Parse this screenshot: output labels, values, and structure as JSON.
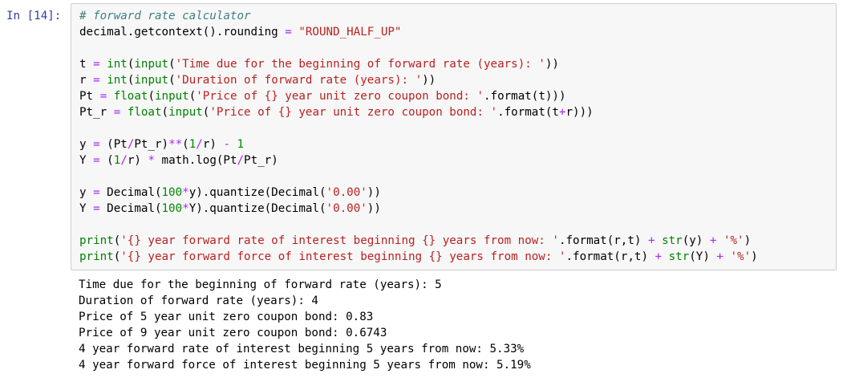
{
  "cell": {
    "prompt": "In [14]:",
    "code_lines": [
      [
        {
          "t": "# forward rate calculator",
          "c": "cm"
        }
      ],
      [
        {
          "t": "decimal.getcontext().rounding ",
          "c": ""
        },
        {
          "t": "=",
          "c": "op"
        },
        {
          "t": " ",
          "c": ""
        },
        {
          "t": "\"ROUND_HALF_UP\"",
          "c": "st"
        }
      ],
      [],
      [
        {
          "t": "t ",
          "c": ""
        },
        {
          "t": "=",
          "c": "op"
        },
        {
          "t": " ",
          "c": ""
        },
        {
          "t": "int",
          "c": "kw"
        },
        {
          "t": "(",
          "c": ""
        },
        {
          "t": "input",
          "c": "kw"
        },
        {
          "t": "(",
          "c": ""
        },
        {
          "t": "'Time due for the beginning of forward rate (years): '",
          "c": "st"
        },
        {
          "t": "))",
          "c": ""
        }
      ],
      [
        {
          "t": "r ",
          "c": ""
        },
        {
          "t": "=",
          "c": "op"
        },
        {
          "t": " ",
          "c": ""
        },
        {
          "t": "int",
          "c": "kw"
        },
        {
          "t": "(",
          "c": ""
        },
        {
          "t": "input",
          "c": "kw"
        },
        {
          "t": "(",
          "c": ""
        },
        {
          "t": "'Duration of forward rate (years): '",
          "c": "st"
        },
        {
          "t": "))",
          "c": ""
        }
      ],
      [
        {
          "t": "Pt ",
          "c": ""
        },
        {
          "t": "=",
          "c": "op"
        },
        {
          "t": " ",
          "c": ""
        },
        {
          "t": "float",
          "c": "kw"
        },
        {
          "t": "(",
          "c": ""
        },
        {
          "t": "input",
          "c": "kw"
        },
        {
          "t": "(",
          "c": ""
        },
        {
          "t": "'Price of {} year unit zero coupon bond: '",
          "c": "st"
        },
        {
          "t": ".format(t)))",
          "c": ""
        }
      ],
      [
        {
          "t": "Pt_r ",
          "c": ""
        },
        {
          "t": "=",
          "c": "op"
        },
        {
          "t": " ",
          "c": ""
        },
        {
          "t": "float",
          "c": "kw"
        },
        {
          "t": "(",
          "c": ""
        },
        {
          "t": "input",
          "c": "kw"
        },
        {
          "t": "(",
          "c": ""
        },
        {
          "t": "'Price of {} year unit zero coupon bond: '",
          "c": "st"
        },
        {
          "t": ".format(t",
          "c": ""
        },
        {
          "t": "+",
          "c": "op"
        },
        {
          "t": "r)))",
          "c": ""
        }
      ],
      [],
      [
        {
          "t": "y ",
          "c": ""
        },
        {
          "t": "=",
          "c": "op"
        },
        {
          "t": " (Pt",
          "c": ""
        },
        {
          "t": "/",
          "c": "op"
        },
        {
          "t": "Pt_r)",
          "c": ""
        },
        {
          "t": "**",
          "c": "op"
        },
        {
          "t": "(",
          "c": ""
        },
        {
          "t": "1",
          "c": "nu"
        },
        {
          "t": "/",
          "c": "op"
        },
        {
          "t": "r) ",
          "c": ""
        },
        {
          "t": "-",
          "c": "op"
        },
        {
          "t": " ",
          "c": ""
        },
        {
          "t": "1",
          "c": "nu"
        }
      ],
      [
        {
          "t": "Y ",
          "c": ""
        },
        {
          "t": "=",
          "c": "op"
        },
        {
          "t": " (",
          "c": ""
        },
        {
          "t": "1",
          "c": "nu"
        },
        {
          "t": "/",
          "c": "op"
        },
        {
          "t": "r) ",
          "c": ""
        },
        {
          "t": "*",
          "c": "op"
        },
        {
          "t": " math.log(Pt",
          "c": ""
        },
        {
          "t": "/",
          "c": "op"
        },
        {
          "t": "Pt_r)",
          "c": ""
        }
      ],
      [],
      [
        {
          "t": "y ",
          "c": ""
        },
        {
          "t": "=",
          "c": "op"
        },
        {
          "t": " Decimal(",
          "c": ""
        },
        {
          "t": "100",
          "c": "nu"
        },
        {
          "t": "*",
          "c": "op"
        },
        {
          "t": "y).quantize(Decimal(",
          "c": ""
        },
        {
          "t": "'0.00'",
          "c": "st"
        },
        {
          "t": "))",
          "c": ""
        }
      ],
      [
        {
          "t": "Y ",
          "c": ""
        },
        {
          "t": "=",
          "c": "op"
        },
        {
          "t": " Decimal(",
          "c": ""
        },
        {
          "t": "100",
          "c": "nu"
        },
        {
          "t": "*",
          "c": "op"
        },
        {
          "t": "Y).quantize(Decimal(",
          "c": ""
        },
        {
          "t": "'0.00'",
          "c": "st"
        },
        {
          "t": "))",
          "c": ""
        }
      ],
      [],
      [
        {
          "t": "print",
          "c": "kw"
        },
        {
          "t": "(",
          "c": ""
        },
        {
          "t": "'{} year forward rate of interest beginning {} years from now: '",
          "c": "st"
        },
        {
          "t": ".format(r,t) ",
          "c": ""
        },
        {
          "t": "+",
          "c": "op"
        },
        {
          "t": " ",
          "c": ""
        },
        {
          "t": "str",
          "c": "kw"
        },
        {
          "t": "(y) ",
          "c": ""
        },
        {
          "t": "+",
          "c": "op"
        },
        {
          "t": " ",
          "c": ""
        },
        {
          "t": "'%'",
          "c": "st"
        },
        {
          "t": ")",
          "c": ""
        }
      ],
      [
        {
          "t": "print",
          "c": "kw"
        },
        {
          "t": "(",
          "c": ""
        },
        {
          "t": "'{} year forward force of interest beginning {} years from now: '",
          "c": "st"
        },
        {
          "t": ".format(r,t) ",
          "c": ""
        },
        {
          "t": "+",
          "c": "op"
        },
        {
          "t": " ",
          "c": ""
        },
        {
          "t": "str",
          "c": "kw"
        },
        {
          "t": "(Y) ",
          "c": ""
        },
        {
          "t": "+",
          "c": "op"
        },
        {
          "t": " ",
          "c": ""
        },
        {
          "t": "'%'",
          "c": "st"
        },
        {
          "t": ")",
          "c": ""
        }
      ]
    ],
    "output_lines": [
      "Time due for the beginning of forward rate (years): 5",
      "Duration of forward rate (years): 4",
      "Price of 5 year unit zero coupon bond: 0.83",
      "Price of 9 year unit zero coupon bond: 0.6743",
      "4 year forward rate of interest beginning 5 years from now: 5.33%",
      "4 year forward force of interest beginning 5 years from now: 5.19%"
    ]
  },
  "colors": {
    "prompt": "#303f9f",
    "comment": "#408080",
    "string": "#ba2121",
    "builtin": "#008000",
    "operator": "#aa22ff",
    "number": "#008800",
    "input_background": "#f7f7f7",
    "input_border": "#cfcfcf"
  }
}
